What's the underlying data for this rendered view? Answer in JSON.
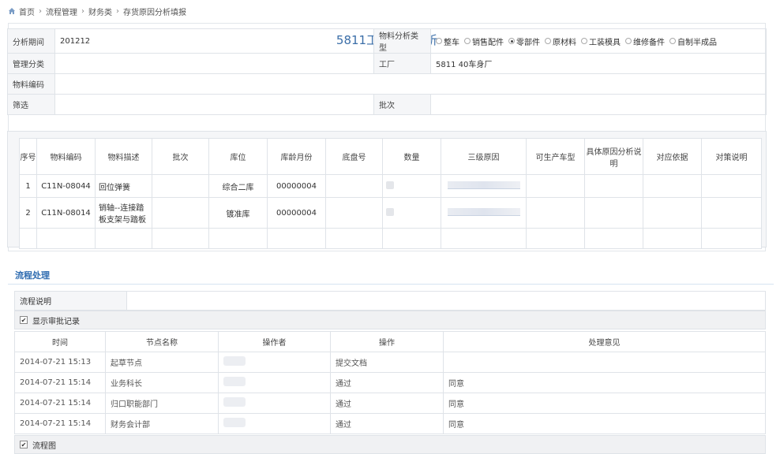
{
  "breadcrumb": {
    "items": [
      "首页",
      "流程管理",
      "财务类",
      "存货原因分析填报"
    ]
  },
  "form": {
    "title": "5811工厂原因分析",
    "fields": {
      "period_label": "分析期间",
      "period_value": "201212",
      "material_type_label": "物料分析类型",
      "mgmt_label": "管理分类",
      "factory_label": "工厂",
      "factory_value": "5811 40车身厂",
      "material_code_label": "物料编码",
      "filter_label": "筛选",
      "batch_label": "批次"
    },
    "material_types": [
      {
        "label": "整车",
        "selected": false
      },
      {
        "label": "销售配件",
        "selected": false
      },
      {
        "label": "零部件",
        "selected": true
      },
      {
        "label": "原材料",
        "selected": false
      },
      {
        "label": "工装模具",
        "selected": false
      },
      {
        "label": "维修备件",
        "selected": false
      },
      {
        "label": "自制半成品",
        "selected": false
      }
    ]
  },
  "detail": {
    "headers": [
      "序号",
      "物料编码",
      "物料描述",
      "批次",
      "库位",
      "库龄月份",
      "底盘号",
      "数量",
      "三级原因",
      "可生产车型",
      "具体原因分析说明",
      "对应依据",
      "对策说明"
    ],
    "rows": [
      {
        "no": "1",
        "code": "C11N-08044",
        "desc": "回位弹簧",
        "batch": "",
        "location": "综合二库",
        "age": "00000004"
      },
      {
        "no": "2",
        "code": "C11N-08014",
        "desc": "销轴--连接踏板支架与踏板",
        "batch": "",
        "location": "镀准库",
        "age": "00000004"
      }
    ]
  },
  "process": {
    "section_title": "流程处理",
    "desc_label": "流程说明",
    "show_records_label": "显示审批记录",
    "flowchart_label": "流程图",
    "log_headers": [
      "时间",
      "节点名称",
      "操作者",
      "操作",
      "处理意见"
    ],
    "log_rows": [
      {
        "time": "2014-07-21 15:13",
        "node": "起草节点",
        "action": "提交文档",
        "opinion": ""
      },
      {
        "time": "2014-07-21 15:14",
        "node": "业务科长",
        "action": "通过",
        "opinion": "同意"
      },
      {
        "time": "2014-07-21 15:14",
        "node": "归口职能部门",
        "action": "通过",
        "opinion": "同意"
      },
      {
        "time": "2014-07-21 15:14",
        "node": "财务会计部",
        "action": "通过",
        "opinion": "同意"
      }
    ]
  }
}
